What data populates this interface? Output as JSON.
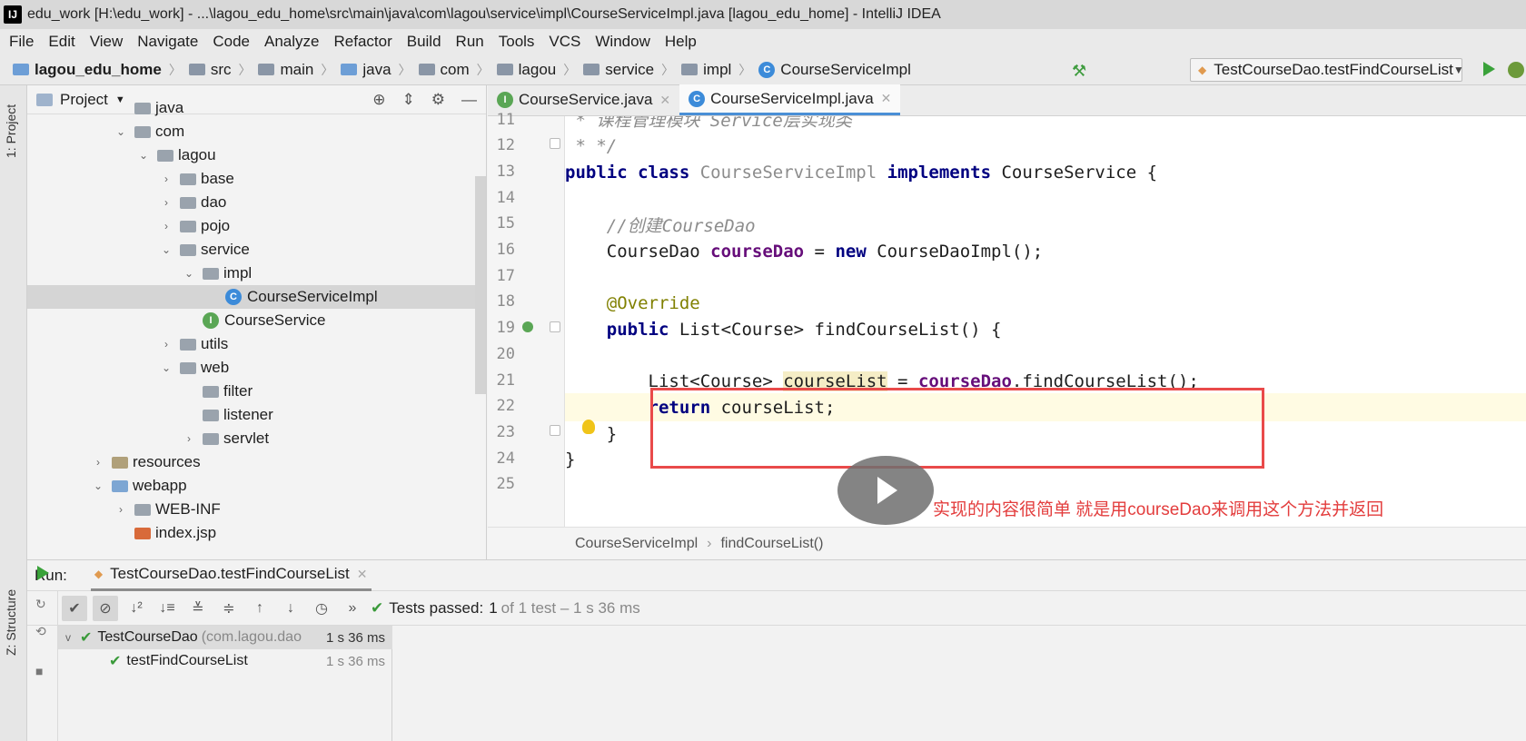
{
  "window": {
    "title": "edu_work [H:\\edu_work] - ...\\lagou_edu_home\\src\\main\\java\\com\\lagou\\service\\impl\\CourseServiceImpl.java [lagou_edu_home] - IntelliJ IDEA"
  },
  "menu": [
    "File",
    "Edit",
    "View",
    "Navigate",
    "Code",
    "Analyze",
    "Refactor",
    "Build",
    "Run",
    "Tools",
    "VCS",
    "Window",
    "Help"
  ],
  "nav": {
    "crumbs": [
      "lagou_edu_home",
      "src",
      "main",
      "java",
      "com",
      "lagou",
      "service",
      "impl",
      "CourseServiceImpl"
    ],
    "run_config": "TestCourseDao.testFindCourseList"
  },
  "left_strip": {
    "project_tab": "1: Project",
    "structure_tab": "Z: Structure"
  },
  "project": {
    "title": "Project",
    "tree": [
      {
        "label": "java",
        "indent": 4,
        "arrow": ""
      },
      {
        "label": "com",
        "indent": 4,
        "arrow": "v"
      },
      {
        "label": "lagou",
        "indent": 5,
        "arrow": "v"
      },
      {
        "label": "base",
        "indent": 6,
        "arrow": ">"
      },
      {
        "label": "dao",
        "indent": 6,
        "arrow": ">"
      },
      {
        "label": "pojo",
        "indent": 6,
        "arrow": ">"
      },
      {
        "label": "service",
        "indent": 6,
        "arrow": "v"
      },
      {
        "label": "impl",
        "indent": 7,
        "arrow": "v"
      },
      {
        "label": "CourseServiceImpl",
        "indent": 8,
        "arrow": "",
        "type": "class"
      },
      {
        "label": "CourseService",
        "indent": 7,
        "arrow": "",
        "type": "interface"
      },
      {
        "label": "utils",
        "indent": 6,
        "arrow": ">"
      },
      {
        "label": "web",
        "indent": 6,
        "arrow": "v"
      },
      {
        "label": "filter",
        "indent": 7,
        "arrow": ""
      },
      {
        "label": "listener",
        "indent": 7,
        "arrow": ""
      },
      {
        "label": "servlet",
        "indent": 7,
        "arrow": ">"
      },
      {
        "label": "resources",
        "indent": 3,
        "arrow": ">"
      },
      {
        "label": "webapp",
        "indent": 3,
        "arrow": "v"
      },
      {
        "label": "WEB-INF",
        "indent": 4,
        "arrow": ">"
      },
      {
        "label": "index.jsp",
        "indent": 4,
        "arrow": ""
      }
    ]
  },
  "editor": {
    "tabs": [
      {
        "label": "CourseService.java",
        "active": false
      },
      {
        "label": "CourseServiceImpl.java",
        "active": true
      }
    ],
    "line_numbers": [
      "11",
      "12",
      "13",
      "14",
      "15",
      "16",
      "17",
      "18",
      "19",
      "20",
      "21",
      "22",
      "23",
      "24",
      "25"
    ],
    "code": {
      "l11": " * 课程管理模块 Service层实现类",
      "l12": " * */",
      "l13_kw1": "public class ",
      "l13_cls": "CourseServiceImpl ",
      "l13_kw2": "implements ",
      "l13_rest": "CourseService {",
      "l15": "    //创建CourseDao",
      "l16_a": "    CourseDao ",
      "l16_f": "courseDao",
      "l16_b": " = ",
      "l16_kw": "new ",
      "l16_c": "CourseDaoImpl();",
      "l18": "    @Override",
      "l19_kw": "    public ",
      "l19_rest": "List<Course> findCourseList() {",
      "l21_a": "        List<Course> ",
      "l21_hl": "courseList",
      "l21_b": " = ",
      "l21_f": "courseDao",
      "l21_c": ".findCourseList();",
      "l22_kw": "        return ",
      "l22_rest": "courseList;",
      "l23": "    }",
      "l24": "}"
    },
    "breadcrumb": [
      "CourseServiceImpl",
      "findCourseList()"
    ]
  },
  "subtitle": "实现的内容很简单 就是用courseDao来调用这个方法并返回",
  "run": {
    "label": "Run:",
    "tab": "TestCourseDao.testFindCourseList",
    "status_prefix": "Tests passed:",
    "status_count": "1",
    "status_detail": "of 1 test – 1 s 36 ms",
    "tests": [
      {
        "name": "TestCourseDao",
        "pkg": "(com.lagou.dao",
        "duration": "1 s 36 ms"
      },
      {
        "name": "testFindCourseList",
        "pkg": "",
        "duration": "1 s 36 ms"
      }
    ]
  }
}
